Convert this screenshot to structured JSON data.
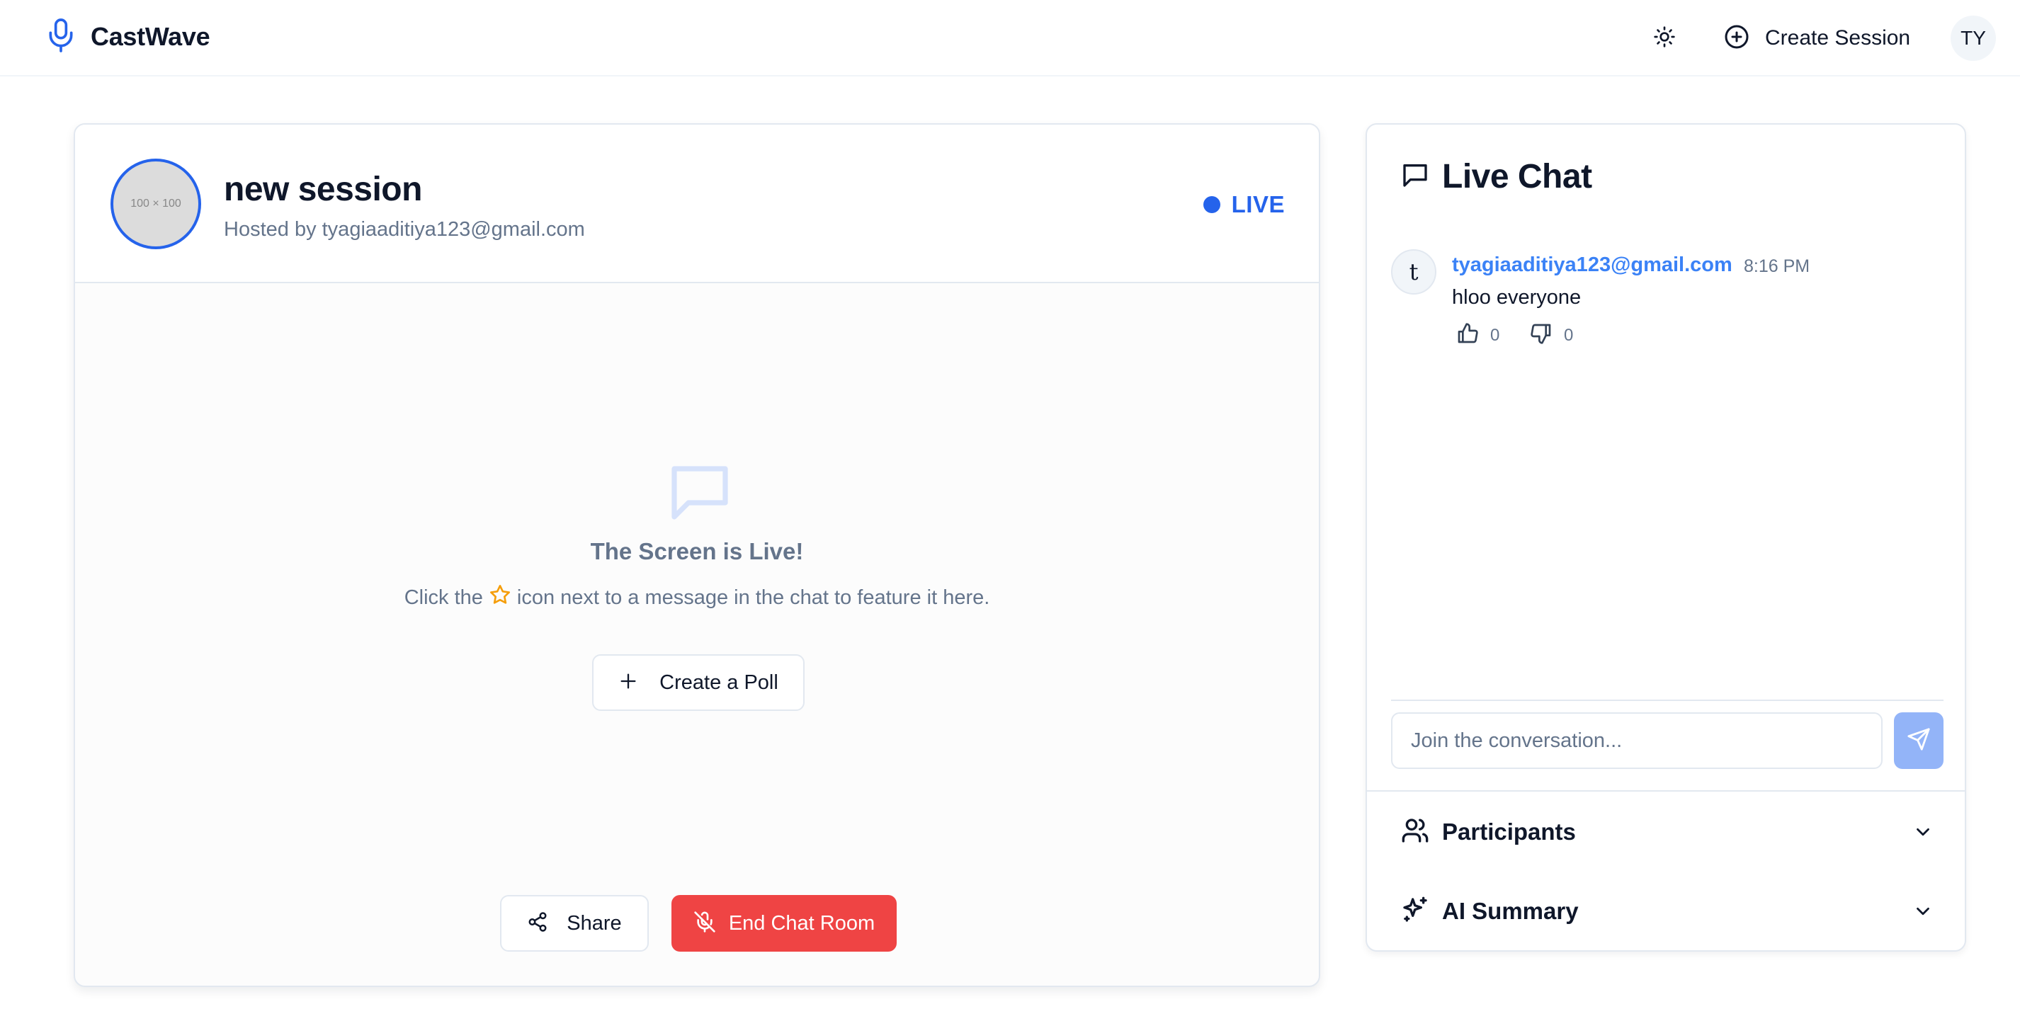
{
  "header": {
    "brand": "CastWave",
    "create_session_label": "Create Session",
    "user_initials": "TY",
    "icons": {
      "brand": "microphone-icon",
      "theme": "sun-icon",
      "create": "plus-circle-icon"
    }
  },
  "session": {
    "avatar_placeholder": "100 × 100",
    "title": "new session",
    "host_line": "Hosted by tyagiaaditiya123@gmail.com",
    "status": "LIVE",
    "status_color": "#2563eb",
    "empty_state": {
      "title": "The Screen is Live!",
      "desc_before": "Click the",
      "desc_after": "icon next to a message in the chat to feature it here."
    },
    "poll_button": "Create a Poll",
    "share_button": "Share",
    "end_button": "End Chat Room",
    "end_button_color": "#ef4444"
  },
  "chat": {
    "title": "Live Chat",
    "messages": [
      {
        "avatar_letter": "t",
        "author": "tyagiaaditiya123@gmail.com",
        "time": "8:16 PM",
        "text": "hloo everyone",
        "likes": "0",
        "dislikes": "0"
      }
    ],
    "input_placeholder": "Join the conversation...",
    "input_value": ""
  },
  "sections": {
    "participants": "Participants",
    "ai_summary": "AI Summary"
  },
  "colors": {
    "accent": "#2563eb",
    "danger": "#ef4444",
    "send_disabled": "#93b4f8",
    "star": "#f59e0b"
  }
}
